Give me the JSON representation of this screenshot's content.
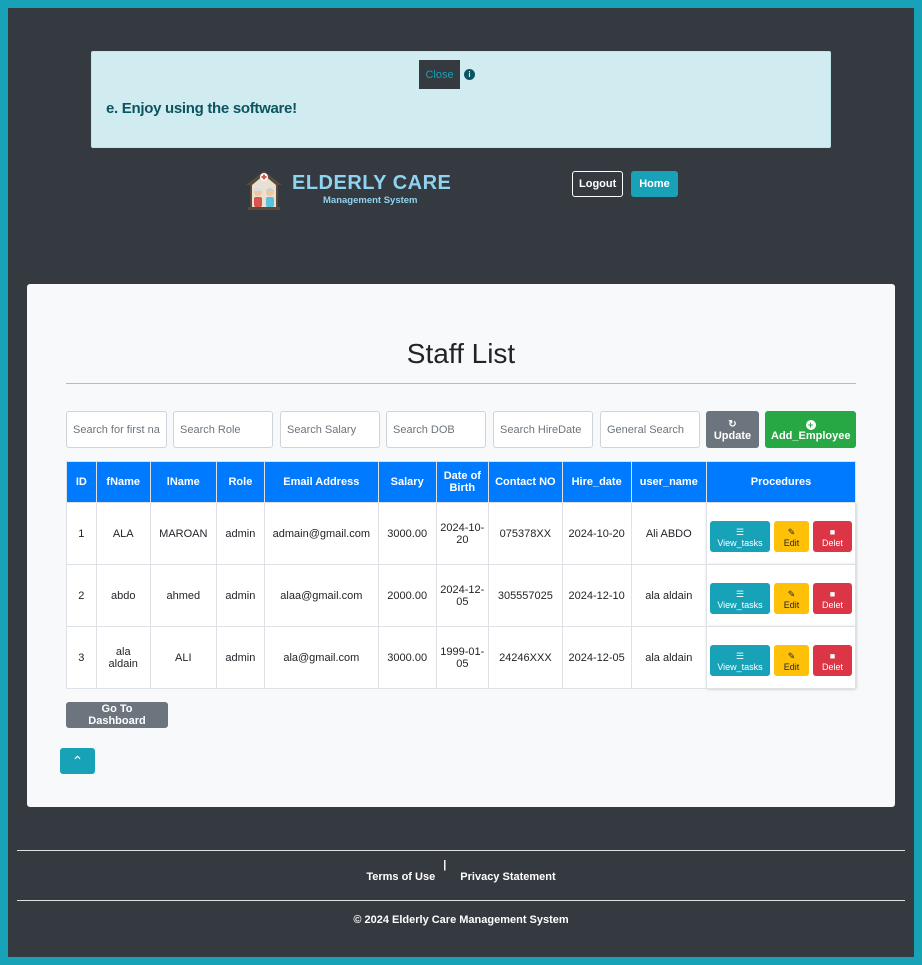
{
  "alert": {
    "close_label": "Close",
    "info_icon": "info-circle-icon",
    "message": "e. Enjoy using the software!"
  },
  "header": {
    "logo_title": "ELDERLY CARE",
    "logo_subtitle": "Management System",
    "logout_label": "Logout",
    "home_label": "Home"
  },
  "main": {
    "title": "Staff List",
    "search": {
      "first_name": "Search for first name",
      "role": "Search Role",
      "salary": "Search Salary",
      "dob": "Search DOB",
      "hire_date": "Search HireDate",
      "general": "General Search"
    },
    "update_label": "Update",
    "update_icon": "refresh-icon",
    "add_label": "Add_Employee",
    "add_icon": "plus-circle-icon",
    "table": {
      "headers": [
        "ID",
        "fName",
        "lName",
        "Role",
        "Email Address",
        "Salary",
        "Date of Birth",
        "Contact NO",
        "Hire_date",
        "user_name",
        "Procedures"
      ],
      "rows": [
        {
          "id": "1",
          "fname": "ALA",
          "lname": "MAROAN",
          "role": "admin",
          "email": "admain@gmail.com",
          "salary": "3000.00",
          "dob": "2024-10-20",
          "contact": "075378XX",
          "hire_date": "2024-10-20",
          "user_name": "Ali ABDO"
        },
        {
          "id": "2",
          "fname": "abdo",
          "lname": "ahmed",
          "role": "admin",
          "email": "alaa@gmail.com",
          "salary": "2000.00",
          "dob": "2024-12-05",
          "contact": "305557025",
          "hire_date": "2024-12-10",
          "user_name": "ala aldain"
        },
        {
          "id": "3",
          "fname": "ala aldain",
          "lname": "ALI",
          "role": "admin",
          "email": "ala@gmail.com",
          "salary": "3000.00",
          "dob": "1999-01-05",
          "contact": "24246XXX",
          "hire_date": "2024-12-05",
          "user_name": "ala aldain"
        }
      ],
      "actions": {
        "view": "View_tasks",
        "edit": "Edit",
        "delete": "Delet"
      }
    },
    "dashboard_label": "Go To Dashboard"
  },
  "footer": {
    "terms": "Terms of Use",
    "separator": "|",
    "privacy": "Privacy Statement",
    "copyright": "© 2024 Elderly Care Management System"
  },
  "colors": {
    "background": "#343a40",
    "border": "#17a2b8",
    "primary": "#007bff",
    "info": "#17a2b8",
    "success": "#28a745",
    "warning": "#ffc107",
    "danger": "#dc3545",
    "secondary": "#6c757d"
  }
}
